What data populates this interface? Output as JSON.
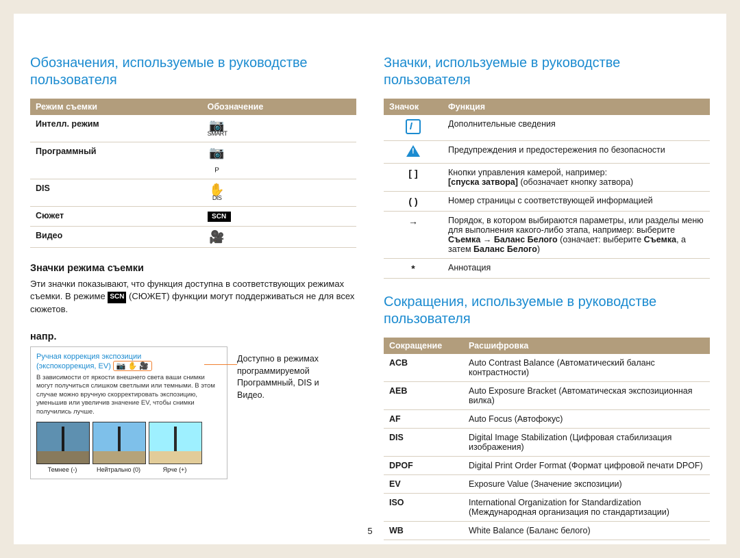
{
  "page_number": "5",
  "left": {
    "title": "Обозначения, используемые в руководстве пользователя",
    "table_headers": [
      "Режим съемки",
      "Обозначение"
    ],
    "modes": [
      {
        "name": "Интелл. режим",
        "label": "SMART"
      },
      {
        "name": "Программный",
        "label": "P"
      },
      {
        "name": "DIS",
        "label": "DIS"
      },
      {
        "name": "Сюжет",
        "label": "SCN"
      },
      {
        "name": "Видео",
        "label": ""
      }
    ],
    "sub_title": "Значки режима съемки",
    "sub_text_a": "Эти значки показывают, что функция доступна в соответствующих режимах съемки. В режиме",
    "sub_text_scn": "SCN",
    "sub_text_paren": " (СЮЖЕТ)",
    "sub_text_b": " функции могут поддерживаться не для всех сюжетов.",
    "example_label": "напр.",
    "example": {
      "ev_title_1": "Ручная коррекция экспозиции",
      "ev_title_2": "(экспокоррекция, EV)",
      "icons": "📷 ✋ 🎥",
      "body": "В зависимости от яркости внешнего света ваши снимки могут получиться слишком светлыми или темными. В этом случае можно вручную скорректировать экспозицию, уменьшив или увеличив значение EV, чтобы снимки получились лучше.",
      "thumbs": [
        {
          "cap": "Темнее (-)"
        },
        {
          "cap": "Нейтрально (0)"
        },
        {
          "cap": "Ярче (+)"
        }
      ]
    },
    "side_note": "Доступно в режимах программируемой Программный, DIS и Видео."
  },
  "right": {
    "icons_title": "Значки, используемые в руководстве пользователя",
    "icons_headers": [
      "Значок",
      "Функция"
    ],
    "icons_rows": [
      {
        "icon": "info",
        "text": "Дополнительные сведения"
      },
      {
        "icon": "warn",
        "text": "Предупреждения и предостережения по безопасности"
      },
      {
        "icon": "[ ]",
        "text_a": "Кнопки управления камерой, например:",
        "bold_inline": "[спуска затвора]",
        "text_b": " (обозначает кнопку затвора)"
      },
      {
        "icon": "( )",
        "text": "Номер страницы с соответствующей информацией"
      },
      {
        "icon": "→",
        "text_a": "Порядок, в котором выбираются параметры, или разделы меню для выполнения какого-либо этапа, например: выберите ",
        "bold1": "Съемка",
        "arrow": " → ",
        "bold2": "Баланс Белого",
        "text_b": " (означает: выберите ",
        "bold3": "Съемка",
        "text_c": ", а затем ",
        "bold4": "Баланс Белого",
        "text_d": ")"
      },
      {
        "icon": "*",
        "text": "Аннотация"
      }
    ],
    "abbr_title": "Сокращения, используемые в руководстве пользователя",
    "abbr_headers": [
      "Сокращение",
      "Расшифровка"
    ],
    "abbr_rows": [
      {
        "abbr": "ACB",
        "def": "Auto Contrast Balance (Автоматический баланс контрастности)"
      },
      {
        "abbr": "AEB",
        "def": "Auto Exposure Bracket (Автоматическая экспозиционная вилка)"
      },
      {
        "abbr": "AF",
        "def": "Auto Focus (Автофокус)"
      },
      {
        "abbr": "DIS",
        "def": "Digital Image Stabilization (Цифровая стабилизация изображения)"
      },
      {
        "abbr": "DPOF",
        "def": "Digital Print Order Format (Формат цифровой печати DPOF)"
      },
      {
        "abbr": "EV",
        "def": "Exposure Value (Значение экспозиции)"
      },
      {
        "abbr": "ISO",
        "def": "International Organization for Standardization (Международная организация по стандартизации)"
      },
      {
        "abbr": "WB",
        "def": "White Balance (Баланс белого)"
      }
    ]
  }
}
